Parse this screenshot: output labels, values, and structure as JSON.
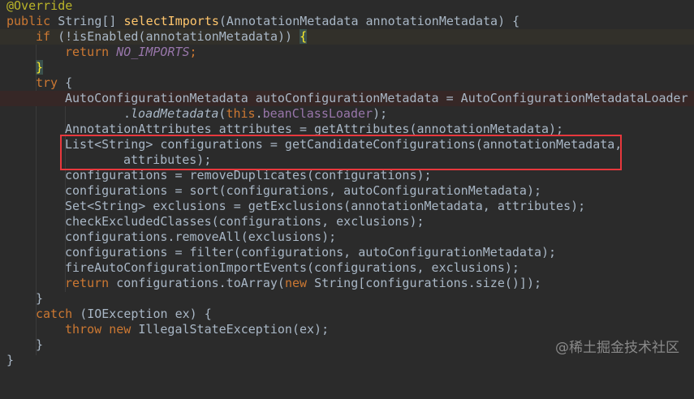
{
  "code": {
    "annotation": "@Override",
    "l1_kw": "public ",
    "l1_type": "String[] ",
    "l1_fn": "selectImports",
    "l1_rest": "(AnnotationMetadata annotationMetadata) {",
    "l2_kw": "if ",
    "l2_rest": "(!isEnabled(annotationMetadata)) ",
    "l2_brace": "{",
    "l3_kw": "return ",
    "l3_const": "NO_IMPORTS",
    "l3_semi": ";",
    "l4_brace": "}",
    "l5_kw": "try ",
    "l5_brace": "{",
    "l6": "AutoConfigurationMetadata autoConfigurationMetadata = AutoConfigurationMetadataLoader",
    "l7_dot": ".",
    "l7_method": "loadMetadata",
    "l7_paren": "(",
    "l7_this": "this",
    "l7_dot2": ".",
    "l7_field": "beanClassLoader",
    "l7_end": ");",
    "l8": "AnnotationAttributes attributes = getAttributes(annotationMetadata);",
    "l9": "List<String> configurations = getCandidateConfigurations(annotationMetadata,",
    "l10": "attributes);",
    "l11": "configurations = removeDuplicates(configurations);",
    "l12": "configurations = sort(configurations, autoConfigurationMetadata);",
    "l13": "Set<String> exclusions = getExclusions(annotationMetadata, attributes);",
    "l14": "checkExcludedClasses(configurations, exclusions);",
    "l15": "configurations.removeAll(exclusions);",
    "l16": "configurations = filter(configurations, autoConfigurationMetadata);",
    "l17": "fireAutoConfigurationImportEvents(configurations, exclusions);",
    "l18_kw": "return ",
    "l18_a": "configurations.toArray(",
    "l18_new": "new ",
    "l18_b": "String[configurations.size()]);",
    "l19": "}",
    "l20_kw": "catch ",
    "l20_rest": "(IOException ex) {",
    "l21_kw": "throw ",
    "l21_new": "new ",
    "l21_rest": "IllegalStateException(ex);",
    "l22": "}",
    "l23": "}"
  },
  "watermark": "@稀土掘金技术社区",
  "colors": {
    "background": "#2b2b2b",
    "keyword": "#cc7832",
    "annotation": "#bbb529",
    "method_decl": "#ffc66d",
    "field": "#9876aa",
    "text": "#a9b7c6",
    "highlight_box": "#e8383d"
  }
}
